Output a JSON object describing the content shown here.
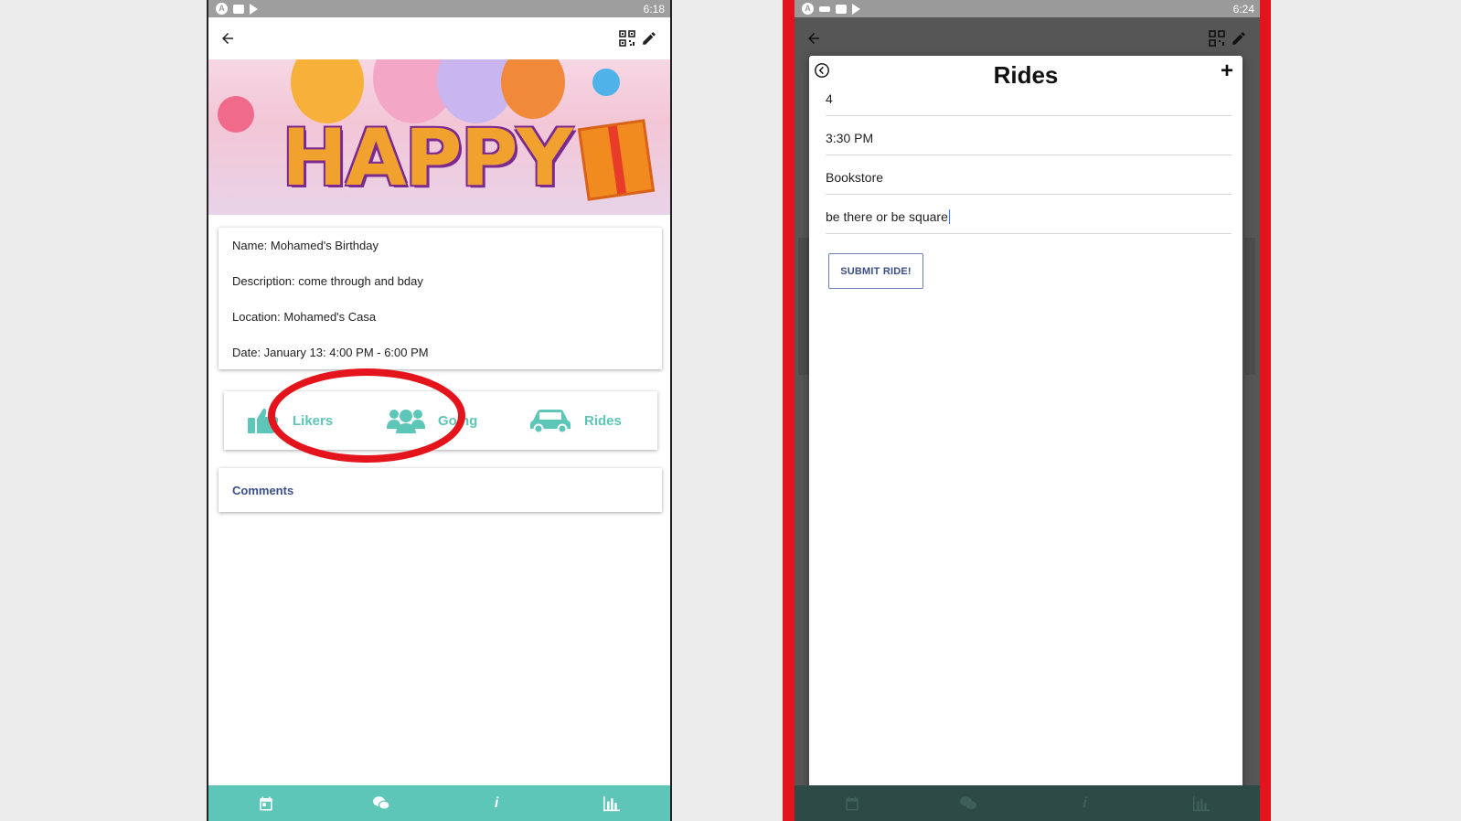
{
  "left_screen": {
    "status_bar": {
      "time": "6:18",
      "icons": [
        "android-auto-icon",
        "folder-icon",
        "play-store-icon"
      ]
    },
    "app_bar": {
      "icons": [
        "back-arrow-icon",
        "qr-code-icon",
        "edit-pencil-icon"
      ]
    },
    "banner": {
      "text": "HAPPY"
    },
    "event_info": {
      "name": "Name: Mohamed's Birthday",
      "description": "Description: come through and bday",
      "location": "Location: Mohamed's Casa",
      "date": "Date: January 13: 4:00 PM - 6:00 PM"
    },
    "actions": {
      "likers": "Likers",
      "going": "Going",
      "rides": "Rides"
    },
    "comments_label": "Comments",
    "bottom_nav": [
      "calendar-icon",
      "chat-icon",
      "info-icon",
      "bar-chart-icon"
    ],
    "highlight_color": "#e3141b",
    "accent_color": "#5ec6b8"
  },
  "right_screen": {
    "status_bar": {
      "time": "6:24"
    },
    "modal": {
      "title": "Rides",
      "fields": {
        "seats": "4",
        "time": "3:30 PM",
        "location": "Bookstore",
        "note": "be there or be square"
      },
      "submit_label": "SUBMIT RIDE!"
    },
    "frame_color": "#e3141b"
  }
}
